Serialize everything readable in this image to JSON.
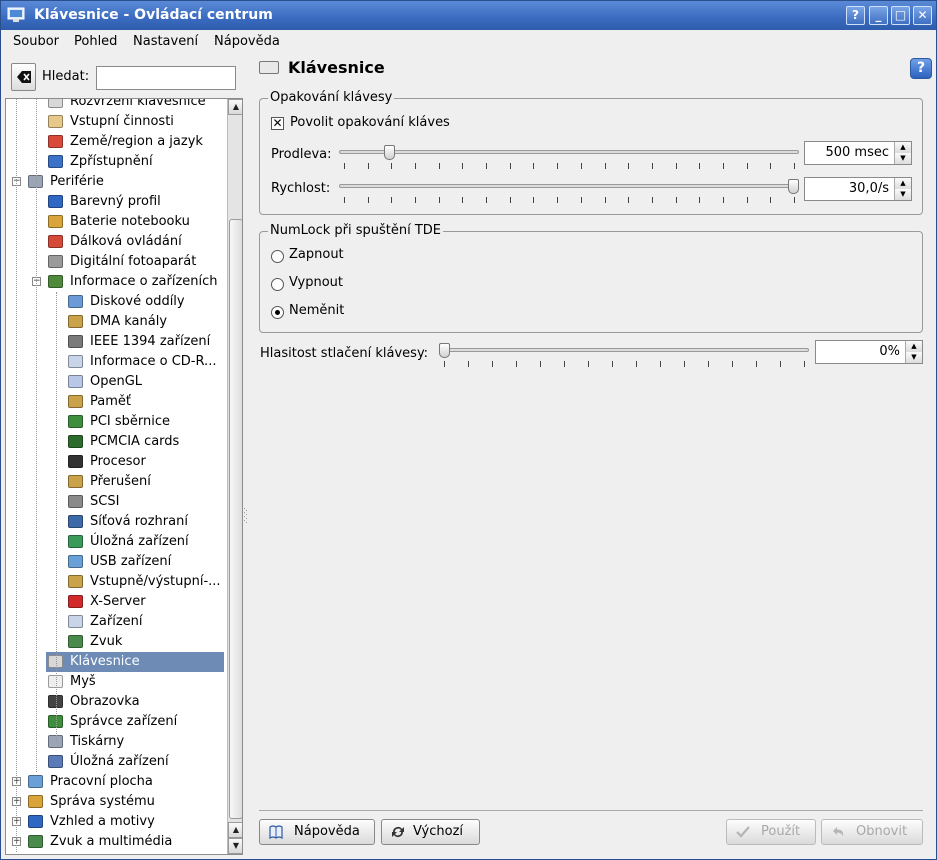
{
  "window": {
    "title": "Klávesnice - Ovládací centrum",
    "buttons": [
      "?",
      "_",
      "□",
      "✕"
    ]
  },
  "menubar": [
    "Soubor",
    "Pohled",
    "Nastavení",
    "Nápověda"
  ],
  "search": {
    "label": "Hledat:",
    "value": "",
    "placeholder": ""
  },
  "tree": {
    "items": [
      {
        "label": "Rozvržení klávesnice",
        "level": 2,
        "icon": "keyboard-layout-icon"
      },
      {
        "label": "Vstupní činnosti",
        "level": 2,
        "icon": "keyboard-actions-icon"
      },
      {
        "label": "Země/region a jazyk",
        "level": 2,
        "icon": "flag-icon"
      },
      {
        "label": "Zpřístupnění",
        "level": 2,
        "icon": "accessibility-icon"
      },
      {
        "label": "Periférie",
        "level": 1,
        "icon": "peripherals-icon",
        "expander": "−"
      },
      {
        "label": "Barevný profil",
        "level": 2,
        "icon": "color-profile-icon"
      },
      {
        "label": "Baterie notebooku",
        "level": 2,
        "icon": "battery-icon"
      },
      {
        "label": "Dálková ovládání",
        "level": 2,
        "icon": "remote-control-icon"
      },
      {
        "label": "Digitální fotoaparát",
        "level": 2,
        "icon": "camera-icon"
      },
      {
        "label": "Informace o zařízeních",
        "level": 2,
        "icon": "device-info-icon",
        "expander": "−"
      },
      {
        "label": "Diskové oddíly",
        "level": 3,
        "icon": "disk-partitions-icon"
      },
      {
        "label": "DMA kanály",
        "level": 3,
        "icon": "dma-icon"
      },
      {
        "label": "IEEE 1394 zařízení",
        "level": 3,
        "icon": "firewire-icon"
      },
      {
        "label": "Informace o CD-R...",
        "level": 3,
        "icon": "cdrom-icon"
      },
      {
        "label": "OpenGL",
        "level": 3,
        "icon": "opengl-icon"
      },
      {
        "label": "Paměť",
        "level": 3,
        "icon": "memory-icon"
      },
      {
        "label": "PCI sběrnice",
        "level": 3,
        "icon": "pci-icon"
      },
      {
        "label": "PCMCIA cards",
        "level": 3,
        "icon": "pcmcia-icon"
      },
      {
        "label": "Procesor",
        "level": 3,
        "icon": "cpu-icon"
      },
      {
        "label": "Přerušení",
        "level": 3,
        "icon": "interrupts-icon"
      },
      {
        "label": "SCSI",
        "level": 3,
        "icon": "scsi-icon"
      },
      {
        "label": "Síťová rozhraní",
        "level": 3,
        "icon": "network-icon"
      },
      {
        "label": "Úložná zařízení",
        "level": 3,
        "icon": "storage-icon"
      },
      {
        "label": "USB zařízení",
        "level": 3,
        "icon": "usb-icon"
      },
      {
        "label": "Vstupně/výstupní-...",
        "level": 3,
        "icon": "io-ports-icon"
      },
      {
        "label": "X-Server",
        "level": 3,
        "icon": "x-server-icon"
      },
      {
        "label": "Zařízení",
        "level": 3,
        "icon": "devices-icon"
      },
      {
        "label": "Zvuk",
        "level": 3,
        "icon": "sound-icon"
      },
      {
        "label": "Klávesnice",
        "level": 2,
        "icon": "keyboard-icon",
        "selected": true
      },
      {
        "label": "Myš",
        "level": 2,
        "icon": "mouse-icon"
      },
      {
        "label": "Obrazovka",
        "level": 2,
        "icon": "display-icon"
      },
      {
        "label": "Správce zařízení",
        "level": 2,
        "icon": "device-manager-icon"
      },
      {
        "label": "Tiskárny",
        "level": 2,
        "icon": "printer-icon"
      },
      {
        "label": "Úložná zařízení",
        "level": 2,
        "icon": "storage-devices-icon"
      },
      {
        "label": "Pracovní plocha",
        "level": 1,
        "icon": "desktop-icon",
        "expander": "+"
      },
      {
        "label": "Správa systému",
        "level": 1,
        "icon": "system-admin-icon",
        "expander": "+"
      },
      {
        "label": "Vzhled a motivy",
        "level": 1,
        "icon": "appearance-icon",
        "expander": "+"
      },
      {
        "label": "Zvuk a multimédia",
        "level": 1,
        "icon": "multimedia-icon",
        "expander": "+"
      }
    ]
  },
  "panel": {
    "title": "Klávesnice",
    "repeat_group": {
      "legend": "Opakování klávesy",
      "enable_label": "Povolit opakování kláves",
      "enabled": true,
      "delay_label": "Prodleva:",
      "delay_value": "500 msec",
      "delay_position": 0.1,
      "rate_label": "Rychlost:",
      "rate_value": "30,0/s",
      "rate_position": 1.0
    },
    "numlock_group": {
      "legend": "NumLock při spuštění TDE",
      "options": [
        "Zapnout",
        "Vypnout",
        "Neměnit"
      ],
      "selected": 2
    },
    "click_volume": {
      "label": "Hlasitost stlačení klávesy:",
      "value": "0%",
      "position": 0.0
    }
  },
  "buttons": {
    "help": "Nápověda",
    "defaults": "Výchozí",
    "apply": "Použít",
    "reset": "Obnovit"
  },
  "colors": {
    "titlebar": "#3a6bc0",
    "selection": "#6d8bb4",
    "background": "#efefef"
  }
}
